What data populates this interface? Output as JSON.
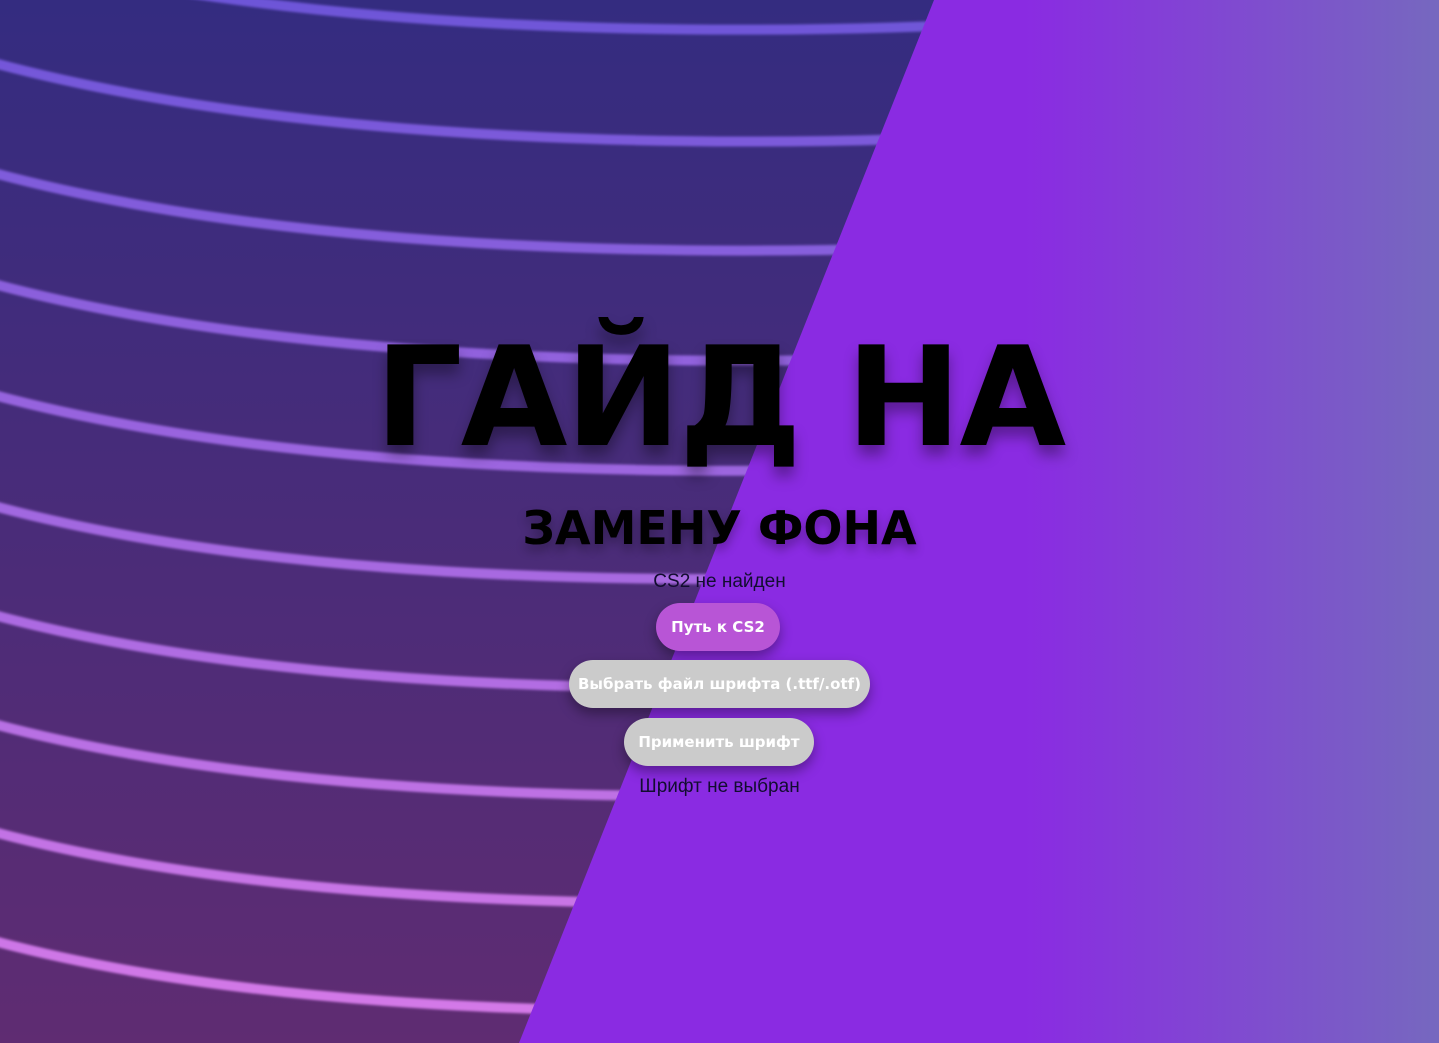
{
  "page": {
    "title_main": "ГАЙД НА",
    "title_sub": "ЗАМЕНУ ФОНА"
  },
  "status": {
    "cs2": "CS2 не найден",
    "font": "Шрифт не выбран"
  },
  "buttons": {
    "cs2_path": "Путь к CS2",
    "choose_font": "Выбрать  файл шрифта (.ttf/.otf)",
    "apply_font": "Применить шрифт"
  },
  "colors": {
    "left_panel_top": "#342c80",
    "left_panel_bottom": "#5f2c72",
    "right_panel_start": "#8a2be2",
    "right_panel_end": "#7668bf",
    "stripe_top": "#6d55d8",
    "stripe_bottom": "#d77ae8",
    "primary_button": "#b855d6",
    "secondary_button": "#cbcbcb"
  }
}
